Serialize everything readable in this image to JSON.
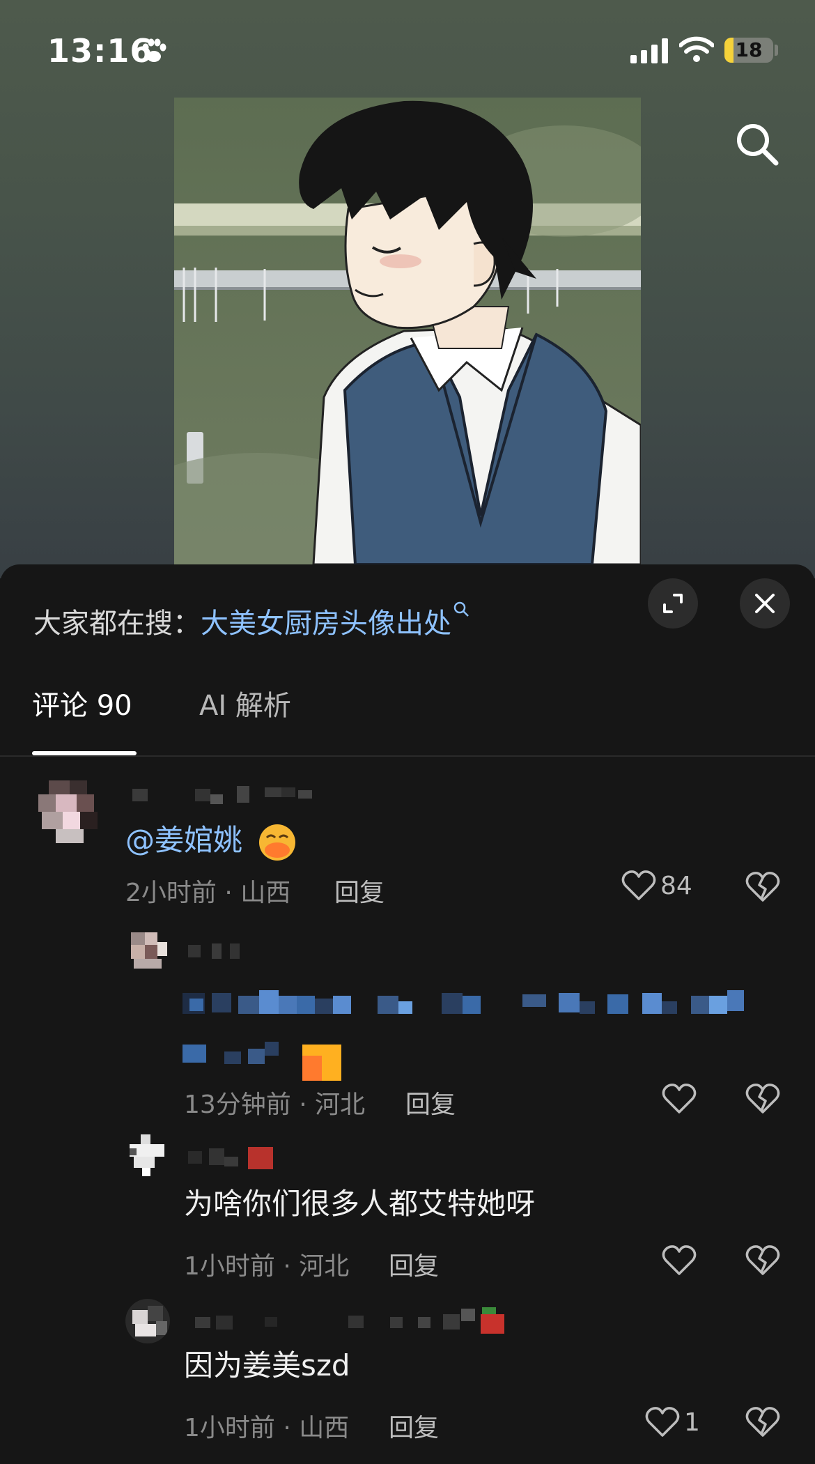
{
  "status_bar": {
    "time": "13:16",
    "battery": "18",
    "battery_level": 0.18
  },
  "trending": {
    "prefix": "大家都在搜：",
    "query": "大美女厨房头像出处"
  },
  "tabs": [
    {
      "label": "评论 90",
      "active": true
    },
    {
      "label": "AI 解析",
      "active": false
    }
  ],
  "comments": [
    {
      "text_mention": "@姜婠姚",
      "meta": "2小时前 · 山西",
      "reply": "回复",
      "likes": "84"
    },
    {
      "meta": "13分钟前 · 河北",
      "reply": "回复",
      "likes": ""
    },
    {
      "text": "为啥你们很多人都艾特她呀",
      "meta": "1小时前 · 河北",
      "reply": "回复",
      "likes": ""
    },
    {
      "text": "因为姜美szd",
      "meta": "1小时前 · 山西",
      "reply": "回复",
      "likes": "1"
    }
  ],
  "colors": {
    "accent": "#8ec2ff",
    "battery": "#f5d23a",
    "sheet": "#161616"
  }
}
